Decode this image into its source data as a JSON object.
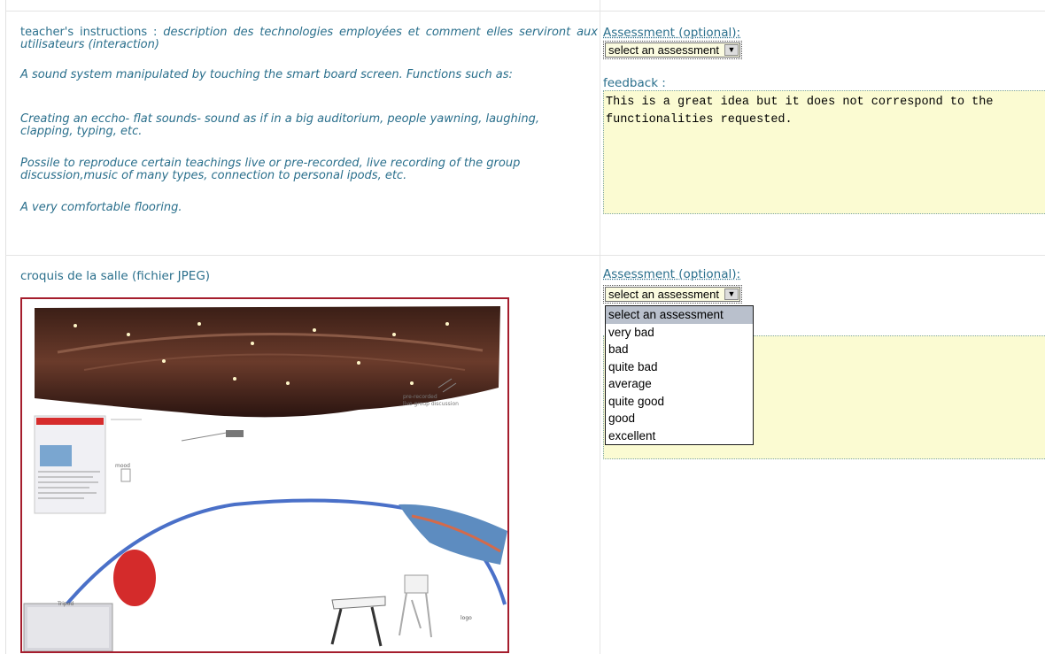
{
  "section1": {
    "instructions_label": "teacher's instructions :",
    "instructions_desc": "description des technologies employées et comment elles serviront aux utilisateurs (interaction)",
    "paragraphs": [
      "A sound system manipulated by touching the smart board screen. Functions such as:",
      "Creating an eccho- flat sounds- sound as if in a big auditorium, people yawning, laughing, clapping, typing, etc.",
      "Possile to reproduce certain teachings live or pre-recorded, live recording of the group discussion,music of many types, connection to personal ipods, etc.",
      "A very comfortable flooring."
    ],
    "assessment_label": "Assessment (optional):",
    "select_value": "select an assessment",
    "feedback_label": "feedback :",
    "feedback_text": "This is a great idea but it does not correspond to the functionalities requested."
  },
  "section2": {
    "sketch_label": "croquis de la salle (fichier JPEG)",
    "assessment_label": "Assessment (optional):",
    "select_value": "select an assessment",
    "options": [
      "select an assessment",
      "very bad",
      "bad",
      "quite bad",
      "average",
      "quite good",
      "good",
      "excellent"
    ],
    "selected_index": 0,
    "sketch_annotations": [
      "pre-recorded / live group discussion",
      "Tripod",
      "mood",
      "logo"
    ]
  },
  "icons": {
    "dropdown_arrow": "chevron-down-icon"
  }
}
